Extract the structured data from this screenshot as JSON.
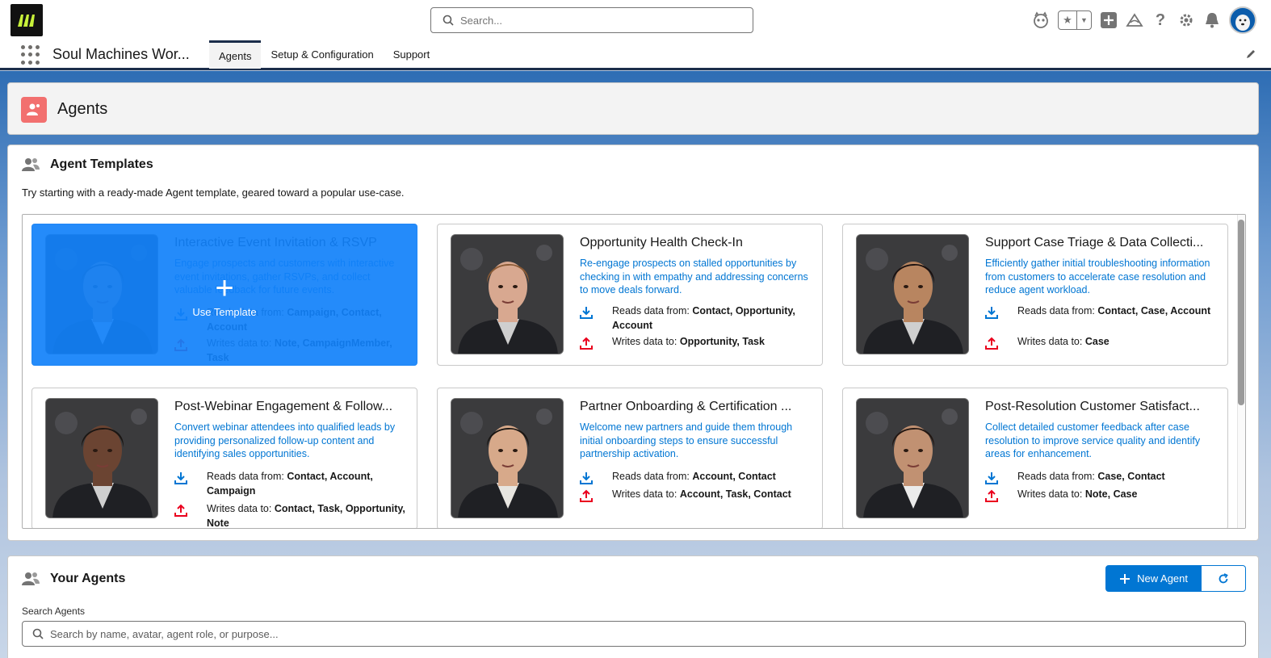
{
  "header": {
    "search_placeholder": "Search..."
  },
  "app": {
    "name": "Soul Machines Wor...",
    "tabs": [
      {
        "label": "Agents",
        "active": true
      },
      {
        "label": "Setup & Configuration",
        "active": false
      },
      {
        "label": "Support",
        "active": false
      }
    ]
  },
  "page": {
    "title": "Agents"
  },
  "templates": {
    "title": "Agent Templates",
    "description": "Try starting with a ready-made Agent template, geared toward a popular use-case.",
    "overlay_label": "Use Template",
    "reads_prefix": "Reads data from: ",
    "writes_prefix": "Writes data to: ",
    "items": [
      {
        "name": "Interactive Event Invitation & RSVP",
        "purpose": "Engage prospects and customers with interactive event invitations, gather RSVPs, and collect valuable feedback for future events.",
        "reads": "Campaign, Contact, Account",
        "writes": "Note, CampaignMember, Task"
      },
      {
        "name": "Opportunity Health Check-In",
        "purpose": "Re-engage prospects on stalled opportunities by checking in with empathy and addressing concerns to move deals forward.",
        "reads": "Contact, Opportunity, Account",
        "writes": "Opportunity, Task"
      },
      {
        "name": "Support Case Triage & Data Collecti...",
        "purpose": "Efficiently gather initial troubleshooting information from customers to accelerate case resolution and reduce agent workload.",
        "reads": "Contact, Case, Account",
        "writes": "Case"
      },
      {
        "name": "Post-Webinar Engagement & Follow...",
        "purpose": "Convert webinar attendees into qualified leads by providing personalized follow-up content and identifying sales opportunities.",
        "reads": "Contact, Account, Campaign",
        "writes": "Contact, Task, Opportunity, Note"
      },
      {
        "name": "Partner Onboarding & Certification ...",
        "purpose": "Welcome new partners and guide them through initial onboarding steps to ensure successful partnership activation.",
        "reads": "Account, Contact",
        "writes": "Account, Task, Contact"
      },
      {
        "name": "Post-Resolution Customer Satisfact...",
        "purpose": "Collect detailed customer feedback after case resolution to improve service quality and identify areas for enhancement.",
        "reads": "Case, Contact",
        "writes": "Note, Case"
      }
    ]
  },
  "your_agents": {
    "title": "Your Agents",
    "new_agent_label": "New Agent",
    "search_label": "Search Agents",
    "search_placeholder": "Search by name, avatar, agent role, or purpose..."
  },
  "colors": {
    "brand_blue": "#0176d3",
    "overlay_blue": "#1181fa",
    "page_icon": "#f2706f",
    "write_icon": "#ea001e"
  },
  "icons": [
    "search-icon",
    "einstein-icon",
    "favorites-star-icon",
    "add-icon",
    "trailhead-icon",
    "help-icon",
    "setup-gear-icon",
    "notifications-bell-icon",
    "user-avatar",
    "app-launcher-icon",
    "edit-pencil-icon",
    "agents-page-icon",
    "group-icon",
    "download-icon",
    "upload-icon",
    "plus-icon",
    "refresh-icon"
  ]
}
